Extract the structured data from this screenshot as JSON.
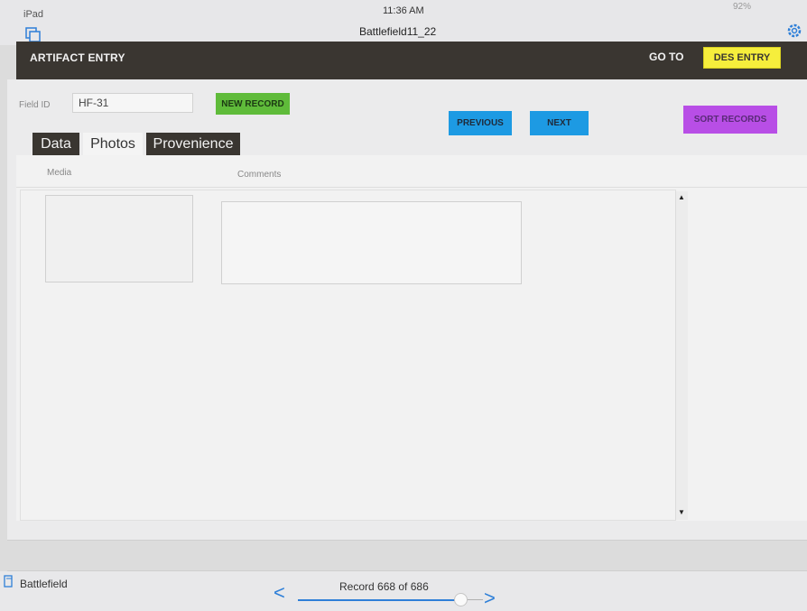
{
  "status_bar": {
    "device": "iPad",
    "time": "11:36 AM",
    "battery": "92%"
  },
  "document_title": "Battlefield11_22",
  "header": {
    "title": "ARTIFACT ENTRY",
    "goto_label": "GO TO",
    "des_entry_label": "DES ENTRY"
  },
  "form": {
    "field_id_label": "Field ID",
    "field_id_value": "HF-31",
    "new_record_label": "NEW RECORD",
    "previous_label": "PREVIOUS",
    "next_label": "NEXT",
    "sort_label": "SORT RECORDS"
  },
  "tabs": [
    {
      "label": "Data",
      "active": false
    },
    {
      "label": "Photos",
      "active": true
    },
    {
      "label": "Provenience",
      "active": false
    }
  ],
  "panel": {
    "media_header": "Media",
    "comments_header": "Comments"
  },
  "bottom_bar": {
    "layout_name": "Battlefield",
    "record_info": "Record 668 of 686",
    "record_position_fraction": 0.974
  },
  "colors": {
    "header_dark": "#3a3631",
    "des_entry_yellow": "#f6ee3c",
    "new_record_green": "#5fbb3a",
    "nav_blue": "#1d9ae3",
    "sort_purple": "#b84ee6",
    "accent_blue": "#2e7fd8"
  },
  "icons": {
    "windows": "windows-icon",
    "settings": "gear-icon",
    "layout": "layout-icon",
    "previous": "chevron-left-icon",
    "next": "chevron-right-icon"
  }
}
